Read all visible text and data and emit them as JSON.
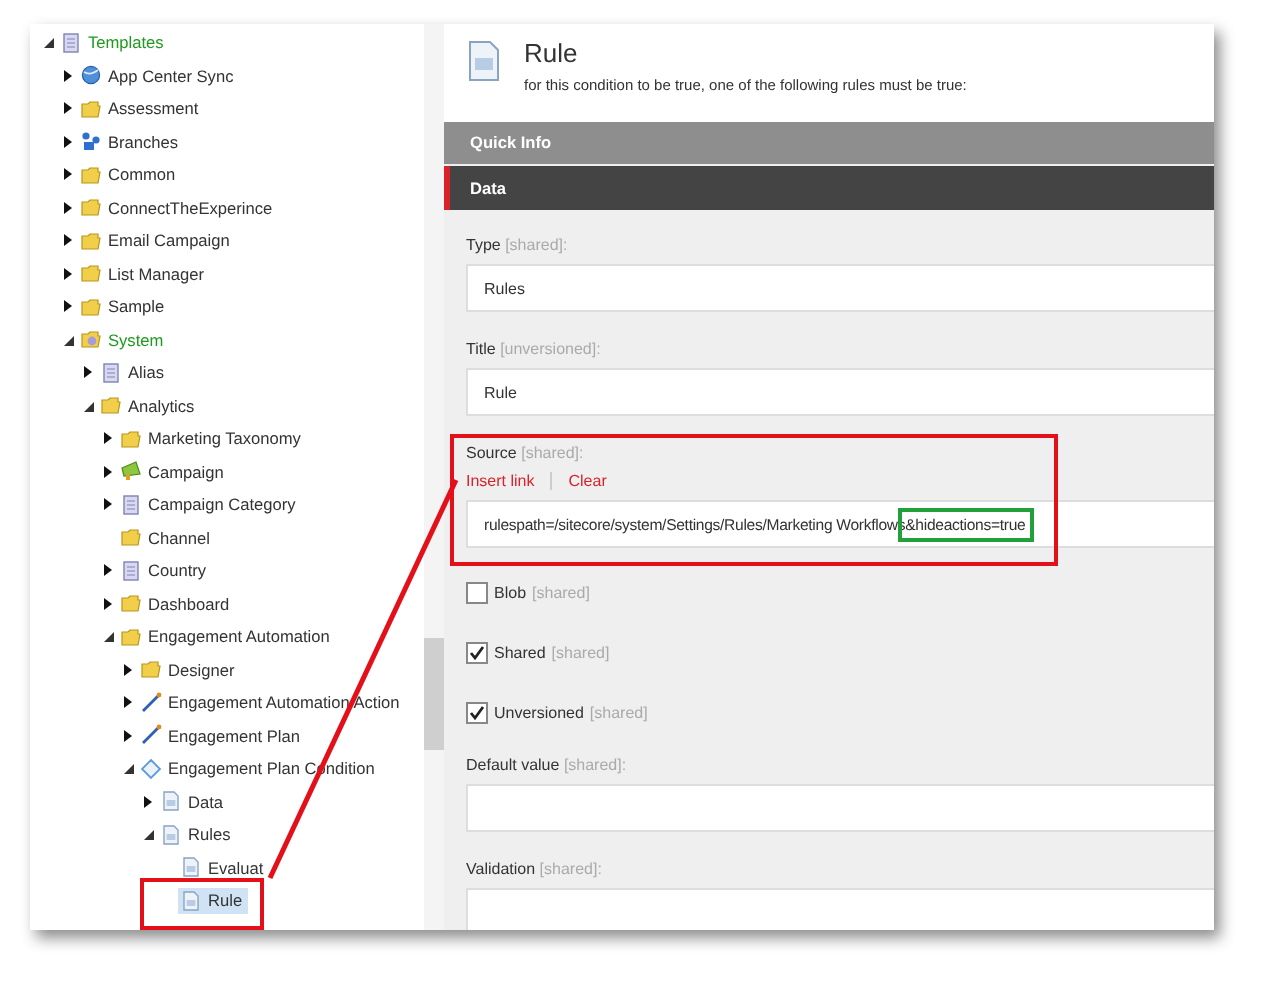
{
  "tree": [
    {
      "label": "Templates",
      "kind": "template",
      "expandable": true,
      "expanded": true,
      "selected": false,
      "highlighted": true,
      "children": [
        {
          "label": "App Center Sync",
          "kind": "globe",
          "expandable": true,
          "expanded": false,
          "selected": false,
          "highlighted": false
        },
        {
          "label": "Assessment",
          "kind": "folder",
          "expandable": true,
          "expanded": false,
          "selected": false,
          "highlighted": false
        },
        {
          "label": "Branches",
          "kind": "branch",
          "expandable": true,
          "expanded": false,
          "selected": false,
          "highlighted": false
        },
        {
          "label": "Common",
          "kind": "folder",
          "expandable": true,
          "expanded": false,
          "selected": false,
          "highlighted": false
        },
        {
          "label": "ConnectTheExperince",
          "kind": "folder",
          "expandable": true,
          "expanded": false,
          "selected": false,
          "highlighted": false
        },
        {
          "label": "Email Campaign",
          "kind": "folder",
          "expandable": true,
          "expanded": false,
          "selected": false,
          "highlighted": false
        },
        {
          "label": "List Manager",
          "kind": "folder",
          "expandable": true,
          "expanded": false,
          "selected": false,
          "highlighted": false
        },
        {
          "label": "Sample",
          "kind": "folder",
          "expandable": true,
          "expanded": false,
          "selected": false,
          "highlighted": false
        },
        {
          "label": "System",
          "kind": "system",
          "expandable": true,
          "expanded": true,
          "selected": false,
          "highlighted": true,
          "children": [
            {
              "label": "Alias",
              "kind": "template",
              "expandable": true,
              "expanded": false,
              "selected": false,
              "highlighted": false
            },
            {
              "label": "Analytics",
              "kind": "folder",
              "expandable": true,
              "expanded": true,
              "selected": false,
              "highlighted": false,
              "children": [
                {
                  "label": "Marketing Taxonomy",
                  "kind": "folder",
                  "expandable": true,
                  "expanded": false,
                  "selected": false,
                  "highlighted": false
                },
                {
                  "label": "Campaign",
                  "kind": "campaign",
                  "expandable": true,
                  "expanded": false,
                  "selected": false,
                  "highlighted": false
                },
                {
                  "label": "Campaign Category",
                  "kind": "template",
                  "expandable": true,
                  "expanded": false,
                  "selected": false,
                  "highlighted": false
                },
                {
                  "label": "Channel",
                  "kind": "folder",
                  "expandable": false,
                  "selected": false,
                  "highlighted": false
                },
                {
                  "label": "Country",
                  "kind": "template",
                  "expandable": true,
                  "expanded": false,
                  "selected": false,
                  "highlighted": false
                },
                {
                  "label": "Dashboard",
                  "kind": "folder",
                  "expandable": true,
                  "expanded": false,
                  "selected": false,
                  "highlighted": false
                },
                {
                  "label": "Engagement Automation",
                  "kind": "folder",
                  "expandable": true,
                  "expanded": true,
                  "selected": false,
                  "highlighted": false,
                  "children": [
                    {
                      "label": "Designer",
                      "kind": "folder",
                      "expandable": true,
                      "expanded": false,
                      "selected": false,
                      "highlighted": false
                    },
                    {
                      "label": "Engagement Automation Action",
                      "kind": "line",
                      "expandable": true,
                      "expanded": false,
                      "selected": false,
                      "highlighted": false
                    },
                    {
                      "label": "Engagement Plan",
                      "kind": "line",
                      "expandable": true,
                      "expanded": false,
                      "selected": false,
                      "highlighted": false
                    },
                    {
                      "label": "Engagement Plan Condition",
                      "kind": "diamond",
                      "expandable": true,
                      "expanded": true,
                      "selected": false,
                      "highlighted": false,
                      "children": [
                        {
                          "label": "Data",
                          "kind": "document",
                          "expandable": true,
                          "expanded": false,
                          "selected": false,
                          "highlighted": false
                        },
                        {
                          "label": "Rules",
                          "kind": "document",
                          "expandable": true,
                          "expanded": true,
                          "selected": false,
                          "highlighted": false,
                          "children": [
                            {
                              "label": "Evaluat",
                              "kind": "document",
                              "expandable": false,
                              "selected": false,
                              "highlighted": false
                            },
                            {
                              "label": "Rule",
                              "kind": "document",
                              "expandable": false,
                              "selected": true,
                              "highlighted": false
                            }
                          ]
                        }
                      ]
                    }
                  ]
                }
              ]
            }
          ]
        }
      ]
    }
  ],
  "header": {
    "title": "Rule",
    "subtitle": "for this condition to be true, one of the following rules must be true:"
  },
  "sections": [
    {
      "label": "Quick Info",
      "selected": false
    },
    {
      "label": "Data",
      "selected": true
    }
  ],
  "fields": [
    {
      "kind": "text",
      "label": "Type",
      "scope": "[shared]:",
      "value": "Rules"
    },
    {
      "kind": "text",
      "label": "Title",
      "scope": "[unversioned]:",
      "value": "Rule"
    },
    {
      "kind": "source",
      "label": "Source",
      "scope": "[shared]:",
      "actions": [
        "Insert link",
        "Clear"
      ],
      "value": "rulespath=/sitecore/system/Settings/Rules/Marketing Workflows",
      "marked_value": "&hideactions=true"
    },
    {
      "kind": "checkbox",
      "label": "Blob",
      "scope": "[shared]",
      "checked": false
    },
    {
      "kind": "checkbox",
      "label": "Shared",
      "scope": "[shared]",
      "checked": true
    },
    {
      "kind": "checkbox",
      "label": "Unversioned",
      "scope": "[shared]",
      "checked": true
    },
    {
      "kind": "text",
      "label": "Default value",
      "scope": "[shared]:"
    },
    {
      "kind": "text",
      "label": "Validation",
      "scope": "[shared]:"
    }
  ]
}
